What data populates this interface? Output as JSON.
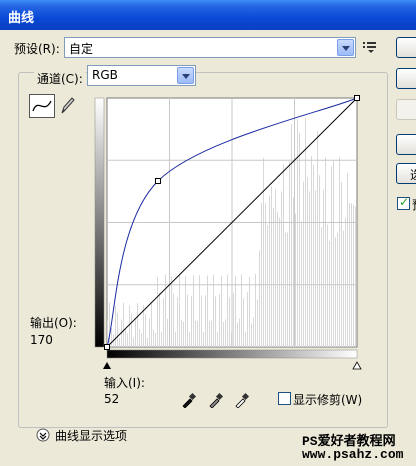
{
  "window": {
    "title": "曲线"
  },
  "preset": {
    "label": "预设(R):",
    "value": "自定"
  },
  "channel": {
    "label": "通道(C):",
    "value": "RGB"
  },
  "output": {
    "label": "输出(O):",
    "value": "170"
  },
  "input": {
    "label": "输入(I):",
    "value": "52"
  },
  "clipping": {
    "label": "显示修剪(W)",
    "checked": false
  },
  "preview": {
    "checked": true,
    "label_partial": "预"
  },
  "side_buttons": [
    {
      "label": ""
    },
    {
      "label": ""
    },
    {
      "label": ""
    },
    {
      "label": ""
    },
    {
      "label": "选"
    }
  ],
  "options": {
    "label": "曲线显示选项"
  },
  "watermark": {
    "line1": "PS爱好者教程网",
    "line2": "www.psahz.com"
  },
  "curve": {
    "point_input": 52,
    "point_output": 170,
    "points": [
      [
        0,
        0
      ],
      [
        52,
        170
      ],
      [
        255,
        255
      ]
    ]
  },
  "icons": [
    "curve-mode-icon",
    "pencil-icon",
    "black-eyedropper-icon",
    "gray-eyedropper-icon",
    "white-eyedropper-icon",
    "expand-chevron-icon",
    "preset-menu-icon"
  ]
}
